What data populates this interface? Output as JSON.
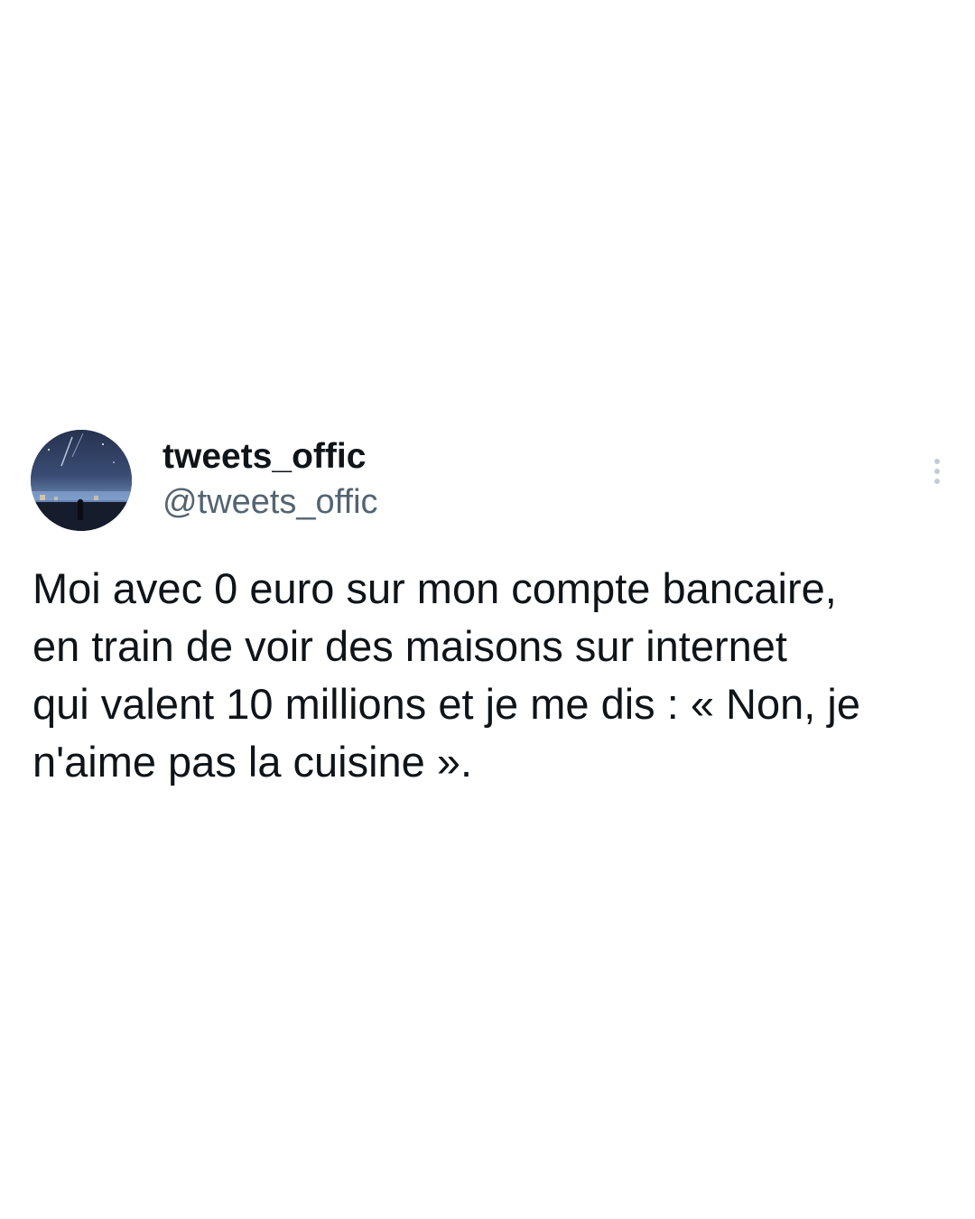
{
  "tweet": {
    "display_name": "tweets_offic",
    "handle": "@tweets_offic",
    "text": "Moi avec 0 euro sur mon compte bancaire,\nen train de voir des maisons sur internet\nqui valent 10 millions et je me dis : « Non, je\nn'aime pas la cuisine ».",
    "more_icon": "more-vertical-icon",
    "avatar_icon": "avatar"
  },
  "colors": {
    "text": "#0f1419",
    "handle": "#536471",
    "more_dots": "#c4cbd2",
    "background": "#ffffff"
  }
}
